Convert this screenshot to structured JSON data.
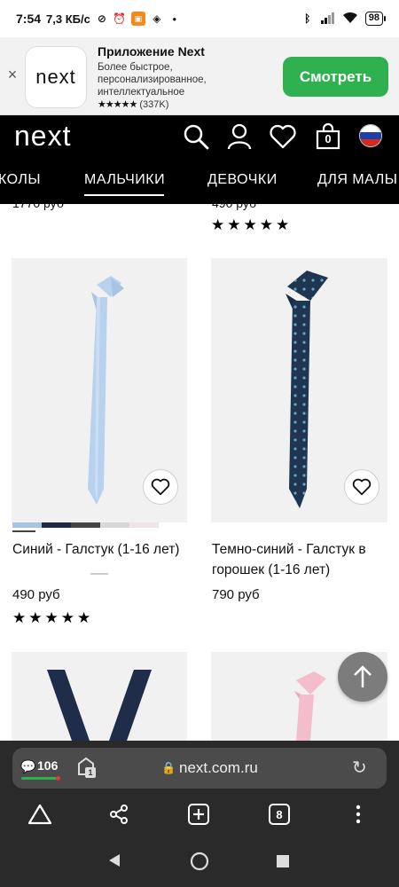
{
  "status_bar": {
    "time": "7:54",
    "speed": "7,3 КБ/с",
    "battery": "98"
  },
  "app_banner": {
    "title": "Приложение Next",
    "description_line1": "Более быстрое,",
    "description_line2": "персонализированное,",
    "description_line3": "интеллектуальное",
    "rating_stars": "★★★★★",
    "rating_count": "(337K)",
    "button": "Смотреть",
    "logo_text": "next",
    "close": "×"
  },
  "site_header": {
    "logo": "next",
    "basket_count": "0"
  },
  "category_nav": {
    "items": [
      "КОЛЫ",
      "МАЛЬЧИКИ",
      "ДЕВОЧКИ",
      "ДЛЯ МАЛЫ"
    ],
    "selected": "МАЛЬЧИКИ"
  },
  "products_partial_top": [
    {
      "price": "1770 руб"
    },
    {
      "price": "490 руб"
    }
  ],
  "products": [
    {
      "title": "Синий - Галстук (1-16 лет)",
      "price": "490 руб",
      "stars": "★★★★★",
      "swatch_colors": [
        "#a8c4e0",
        "#1e2a44",
        "#444444",
        "#d8d8d8",
        "#f0e4e4"
      ]
    },
    {
      "title_line1": "Темно-синий - Галстук в",
      "title_line2": "горошек (1-16 лет)",
      "price": "790 руб"
    }
  ],
  "browser": {
    "comment_count": "106",
    "tab_badge": "1",
    "url": "next.com.ru",
    "tabs_count": "8"
  },
  "colors": {
    "banner_button": "#2fb14f",
    "header_bg": "#000000",
    "browser_bg": "#2a2a2a"
  }
}
